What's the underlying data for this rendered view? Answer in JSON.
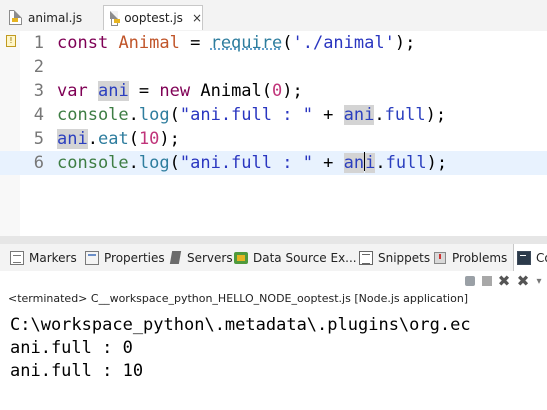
{
  "editor_tabs": [
    {
      "label": "animal.js",
      "active": false
    },
    {
      "label": "ooptest.js",
      "active": true,
      "close": "×"
    }
  ],
  "editor": {
    "current_line": 6,
    "lines": [
      {
        "number": "1",
        "tokens": [
          {
            "text": "const",
            "cls": "kw"
          },
          {
            "text": " "
          },
          {
            "text": "Animal",
            "cls": "cls"
          },
          {
            "text": " = "
          },
          {
            "text": "require",
            "cls": "fn"
          },
          {
            "text": "("
          },
          {
            "text": "'./animal'",
            "cls": "str"
          },
          {
            "text": ");"
          }
        ]
      },
      {
        "number": "2",
        "tokens": []
      },
      {
        "number": "3",
        "tokens": [
          {
            "text": "var",
            "cls": "kw"
          },
          {
            "text": " "
          },
          {
            "text": "ani",
            "cls": "var hl"
          },
          {
            "text": " = "
          },
          {
            "text": "new",
            "cls": "kw"
          },
          {
            "text": " Animal("
          },
          {
            "text": "0",
            "cls": "num"
          },
          {
            "text": ");"
          }
        ]
      },
      {
        "number": "4",
        "tokens": [
          {
            "text": "console",
            "cls": "con"
          },
          {
            "text": "."
          },
          {
            "text": "log",
            "cls": "fnc"
          },
          {
            "text": "("
          },
          {
            "text": "\"ani.full : \"",
            "cls": "str"
          },
          {
            "text": " + "
          },
          {
            "text": "ani",
            "cls": "var hl"
          },
          {
            "text": "."
          },
          {
            "text": "full",
            "cls": "var"
          },
          {
            "text": ");"
          }
        ]
      },
      {
        "number": "5",
        "tokens": [
          {
            "text": "ani",
            "cls": "var hl"
          },
          {
            "text": "."
          },
          {
            "text": "eat",
            "cls": "fnc"
          },
          {
            "text": "("
          },
          {
            "text": "10",
            "cls": "num"
          },
          {
            "text": ");"
          }
        ]
      },
      {
        "number": "6",
        "tokens": [
          {
            "text": "console",
            "cls": "con"
          },
          {
            "text": "."
          },
          {
            "text": "log",
            "cls": "fnc"
          },
          {
            "text": "("
          },
          {
            "text": "\"ani.full : \"",
            "cls": "str"
          },
          {
            "text": " + "
          },
          {
            "text": "an",
            "cls": "var hl"
          },
          {
            "caret": true
          },
          {
            "text": "i",
            "cls": "var hl"
          },
          {
            "text": "."
          },
          {
            "text": "full",
            "cls": "var"
          },
          {
            "text": ");"
          }
        ]
      }
    ]
  },
  "view_tabs": [
    {
      "label": "Markers",
      "icon": "markers-icon"
    },
    {
      "label": "Properties",
      "icon": "properties-icon"
    },
    {
      "label": "Servers",
      "icon": "servers-icon"
    },
    {
      "label": "Data Source Ex...",
      "icon": "data-source-icon"
    },
    {
      "label": "Snippets",
      "icon": "snippets-icon"
    },
    {
      "label": "Problems",
      "icon": "problems-icon"
    },
    {
      "label": "Co",
      "icon": "console-icon",
      "active": true
    }
  ],
  "console": {
    "terminated_label": "<terminated> C__workspace_python_HELLO_NODE_ooptest.js [Node.js application]",
    "output": [
      "C:\\workspace_python\\.metadata\\.plugins\\org.ec",
      "ani.full : 0",
      "ani.full : 10"
    ]
  }
}
